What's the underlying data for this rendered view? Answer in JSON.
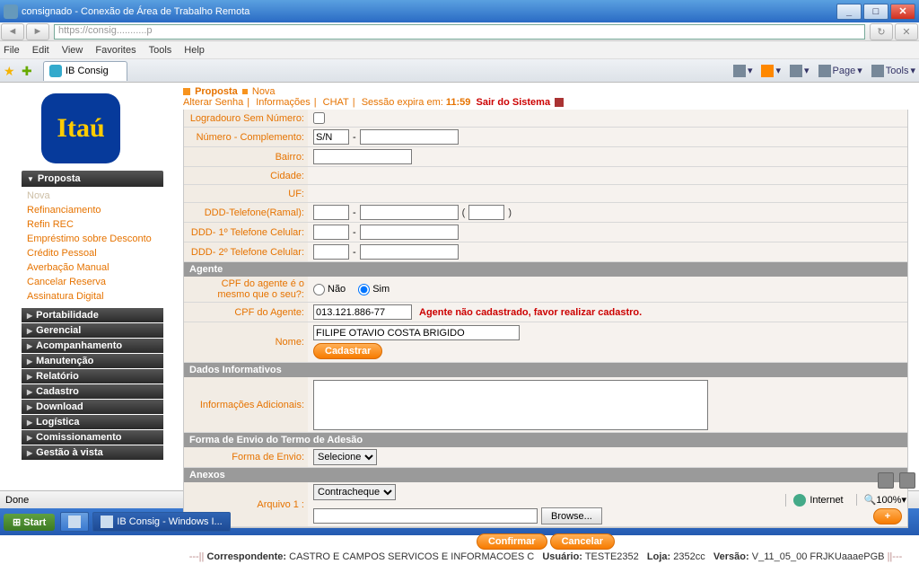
{
  "window": {
    "title": "consignado - Conexão de Área de Trabalho Remota"
  },
  "ie": {
    "url": "https://consig...........p",
    "menu": [
      "File",
      "Edit",
      "View",
      "Favorites",
      "Tools",
      "Help"
    ],
    "tab": "IB Consig",
    "tools": {
      "page": "Page",
      "tools": "Tools"
    }
  },
  "logo": "Itaú",
  "sidebar": {
    "head": "Proposta",
    "links": [
      "Nova",
      "Refinanciamento",
      "Refin REC",
      "Empréstimo sobre Desconto",
      "Crédito Pessoal",
      "Averbação Manual",
      "Cancelar Reserva",
      "Assinatura Digital"
    ],
    "cats": [
      "Portabilidade",
      "Gerencial",
      "Acompanhamento",
      "Manutenção",
      "Relatório",
      "Cadastro",
      "Download",
      "Logística",
      "Comissionamento",
      "Gestão à vista"
    ]
  },
  "breadcrumb": {
    "a": "Proposta",
    "b": "Nova"
  },
  "subbar": {
    "alterar": "Alterar Senha",
    "info": "Informações",
    "chat": "CHAT",
    "expire_lbl": "Sessão expira em:",
    "expire_val": "11:59",
    "exit": "Sair do Sistema"
  },
  "form": {
    "logradouro": "Logradouro Sem Número:",
    "numcomp": "Número - Complemento:",
    "numcomp_val": "S/N",
    "bairro": "Bairro:",
    "cidade": "Cidade:",
    "uf": "UF:",
    "ddd_tel": "DDD-Telefone(Ramal):",
    "ddd_cel1": "DDD- 1º Telefone Celular:",
    "ddd_cel2": "DDD- 2º Telefone Celular:",
    "agente_h": "Agente",
    "cpf_q": "CPF do agente é o mesmo que o seu?:",
    "nao": "Não",
    "sim": "Sim",
    "cpf_lbl": "CPF do Agente:",
    "cpf_val": "013.121.886-77",
    "cpf_err": "Agente não cadastrado, favor realizar cadastro.",
    "nome_lbl": "Nome:",
    "nome_val": "FILIPE OTAVIO COSTA BRIGIDO",
    "cadastrar": "Cadastrar",
    "dados_h": "Dados Informativos",
    "info_add": "Informações Adicionais:",
    "envio_h": "Forma de Envio do Termo de Adesão",
    "forma_envio": "Forma de Envio:",
    "forma_sel": "Selecione",
    "anexos_h": "Anexos",
    "arq1": "Arquivo 1 :",
    "arq1_sel": "Contracheque",
    "browse": "Browse...",
    "plus": "+",
    "confirmar": "Confirmar",
    "cancelar": "Cancelar"
  },
  "footer": {
    "corr_lbl": "Correspondente:",
    "corr_val": "CASTRO E CAMPOS SERVICOS E INFORMACOES C",
    "user_lbl": "Usuário:",
    "user_val": "TESTE2352",
    "loja_lbl": "Loja:",
    "loja_val": "2352cc",
    "ver_lbl": "Versão:",
    "ver_val": "V_11_05_00  FRJKUaaaePGB"
  },
  "status": {
    "done": "Done",
    "zone": "Internet",
    "zoom": "100%"
  },
  "taskbar": {
    "start": "Start",
    "task": "IB Consig - Windows I..."
  }
}
